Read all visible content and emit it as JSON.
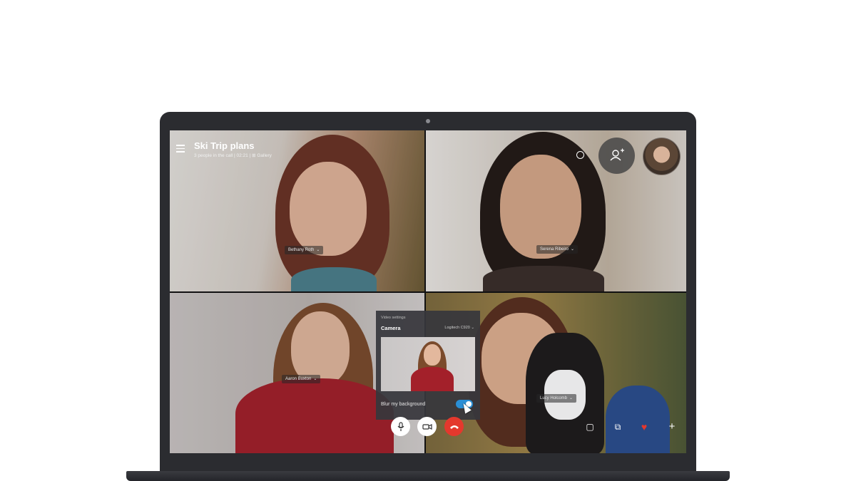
{
  "call": {
    "title": "Ski Trip plans",
    "meta": "3 people in the call | 02:21 | ⊞ Gallery"
  },
  "participants": [
    {
      "name": "Bethany Roth"
    },
    {
      "name": "Serena Ribeiro"
    },
    {
      "name": "Aaron Buxton"
    },
    {
      "name": "Lucy Holcomb"
    }
  ],
  "video_settings": {
    "heading": "Video settings",
    "camera_label": "Camera",
    "camera_device": "Logitech C920 ⌄",
    "blur_label": "Blur my background",
    "blur_enabled": true
  },
  "icons": {
    "menu": "hamburger-menu-icon",
    "ring": "ring-icon",
    "add_people": "add-person-icon",
    "mic": "microphone-icon",
    "video": "video-camera-icon",
    "end_call": "end-call-icon",
    "chat": "chat-icon",
    "switch_camera": "switch-camera-icon",
    "reaction": "heart-icon",
    "more": "plus-icon"
  },
  "glyphs": {
    "chevron": "⌄",
    "mic": "🎙",
    "video": "▭",
    "end_call": "☎",
    "chat": "▢",
    "switch": "⧉",
    "heart": "♥",
    "plus": "+",
    "add_person": "☺"
  },
  "colors": {
    "end_call": "#e4382d",
    "toggle_on": "#2a8fd6",
    "laptop_frame": "#2b2c30"
  }
}
